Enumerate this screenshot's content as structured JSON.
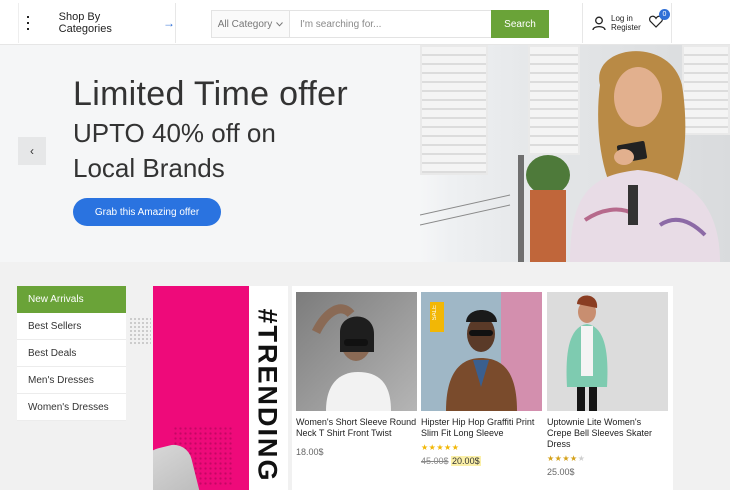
{
  "header": {
    "categories_label": "Shop By Categories",
    "search": {
      "category": "All Category",
      "placeholder": "I'm searching for...",
      "button": "Search"
    },
    "account": {
      "login": "Log in",
      "register": "Register"
    },
    "wishlist_count": "0"
  },
  "hero": {
    "title": "Limited Time offer",
    "subtitle_line1": "UPTO 40% off on",
    "subtitle_line2": "Local Brands",
    "cta": "Grab this Amazing offer",
    "prev_arrow": "‹"
  },
  "side_menu": {
    "items": [
      {
        "label": "New Arrivals",
        "active": true
      },
      {
        "label": "Best Sellers",
        "active": false
      },
      {
        "label": "Best Deals",
        "active": false
      },
      {
        "label": "Men's Dresses",
        "active": false
      },
      {
        "label": "Women's Dresses",
        "active": false
      }
    ]
  },
  "trending": {
    "text": "#TRENDING"
  },
  "products": [
    {
      "name": "Women's Short Sleeve Round Neck T Shirt Front Twist",
      "price": "18.00$",
      "rating": 0
    },
    {
      "name": "Hipster Hip Hop Graffiti Print Slim Fit Long Sleeve",
      "old_price": "45.00$",
      "price": "20.00$",
      "rating": 5,
      "badge": "SALE"
    },
    {
      "name": "Uptownie Lite Women's Crepe Bell Sleeves Skater Dress",
      "price": "25.00$",
      "rating": 4
    }
  ],
  "colors": {
    "accent_green": "#6aa338",
    "accent_blue": "#2a73e0",
    "pink": "#ee0a7a",
    "star_gold": "#f2b705"
  }
}
